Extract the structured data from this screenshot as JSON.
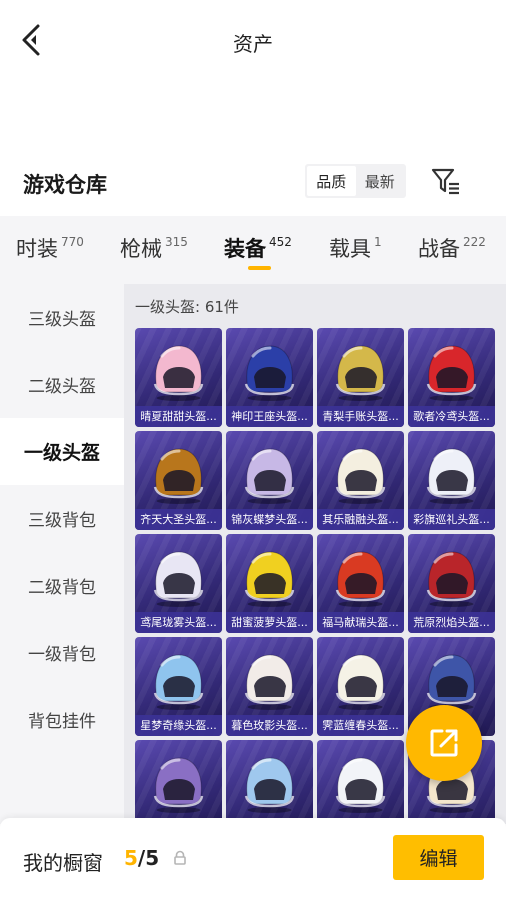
{
  "header": {
    "title": "资产"
  },
  "section": {
    "title": "游戏仓库",
    "sort_quality": "品质",
    "sort_latest": "最新"
  },
  "tabs": [
    {
      "label": "时装",
      "count": "770"
    },
    {
      "label": "枪械",
      "count": "315"
    },
    {
      "label": "装备",
      "count": "452"
    },
    {
      "label": "载具",
      "count": "1"
    },
    {
      "label": "战备",
      "count": "222"
    }
  ],
  "sidebar": {
    "items": [
      {
        "label": "三级头盔"
      },
      {
        "label": "二级头盔"
      },
      {
        "label": "一级头盔"
      },
      {
        "label": "三级背包"
      },
      {
        "label": "二级背包"
      },
      {
        "label": "一级背包"
      },
      {
        "label": "背包挂件"
      }
    ]
  },
  "content": {
    "title": "一级头盔: 61件",
    "items": [
      {
        "name": "晴夏甜甜头盔...",
        "color": "#f3b8cf"
      },
      {
        "name": "神印王座头盔...",
        "color": "#2b3fa8"
      },
      {
        "name": "青梨手账头盔...",
        "color": "#d4b84a"
      },
      {
        "name": "歌者冷鸢头盔...",
        "color": "#d8262b"
      },
      {
        "name": "齐天大圣头盔...",
        "color": "#b8761c"
      },
      {
        "name": "锦灰蝶梦头盔...",
        "color": "#c7b8e6"
      },
      {
        "name": "其乐融融头盔...",
        "color": "#f4efe0"
      },
      {
        "name": "彩旗巡礼头盔...",
        "color": "#eef0f8"
      },
      {
        "name": "鸢尾珑雾头盔...",
        "color": "#e8e6f4"
      },
      {
        "name": "甜蜜菠萝头盔...",
        "color": "#f0d020"
      },
      {
        "name": "福马献瑞头盔...",
        "color": "#d93a22"
      },
      {
        "name": "荒原烈焰头盔...",
        "color": "#b9252a"
      },
      {
        "name": "星梦奇缘头盔...",
        "color": "#8fc4ee"
      },
      {
        "name": "暮色玫影头盔...",
        "color": "#f2ece8"
      },
      {
        "name": "霁蓝缠春头盔...",
        "color": "#f5f2e6"
      },
      {
        "name": "",
        "color": "#3e55a8"
      },
      {
        "name": "",
        "color": "#8a6fc4"
      },
      {
        "name": "",
        "color": "#9fc8ee"
      },
      {
        "name": "",
        "color": "#f2f4f8"
      },
      {
        "name": "",
        "color": "#f4e6cc"
      }
    ]
  },
  "footer": {
    "label": "我的橱窗",
    "current": "5",
    "separator": "/",
    "max": "5",
    "edit_label": "编辑"
  },
  "colors": {
    "accent": "#ffb400",
    "card_bg": "#342a78",
    "card_label_bg": "#3c3296"
  }
}
